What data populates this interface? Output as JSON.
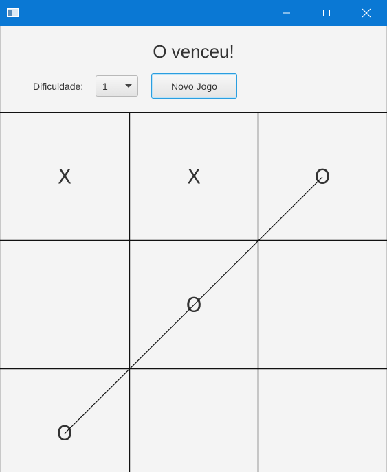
{
  "window": {
    "icons": [
      "app-icon",
      "minimize-icon",
      "maximize-icon",
      "close-icon"
    ]
  },
  "status": {
    "text": "O venceu!"
  },
  "controls": {
    "difficulty_label": "Dificuldade:",
    "difficulty_value": "1",
    "new_game_label": "Novo Jogo"
  },
  "board": {
    "cells": [
      {
        "mark": "X"
      },
      {
        "mark": "X"
      },
      {
        "mark": "O"
      },
      {
        "mark": ""
      },
      {
        "mark": "O"
      },
      {
        "mark": ""
      },
      {
        "mark": "O"
      },
      {
        "mark": ""
      },
      {
        "mark": ""
      }
    ],
    "winning_line": {
      "from_cell": 6,
      "to_cell": 2
    }
  },
  "colors": {
    "titlebar": "#0a78d4",
    "background": "#f4f4f4",
    "text": "#333333",
    "grid": "#111111",
    "button_focus": "#2a9ee0"
  }
}
